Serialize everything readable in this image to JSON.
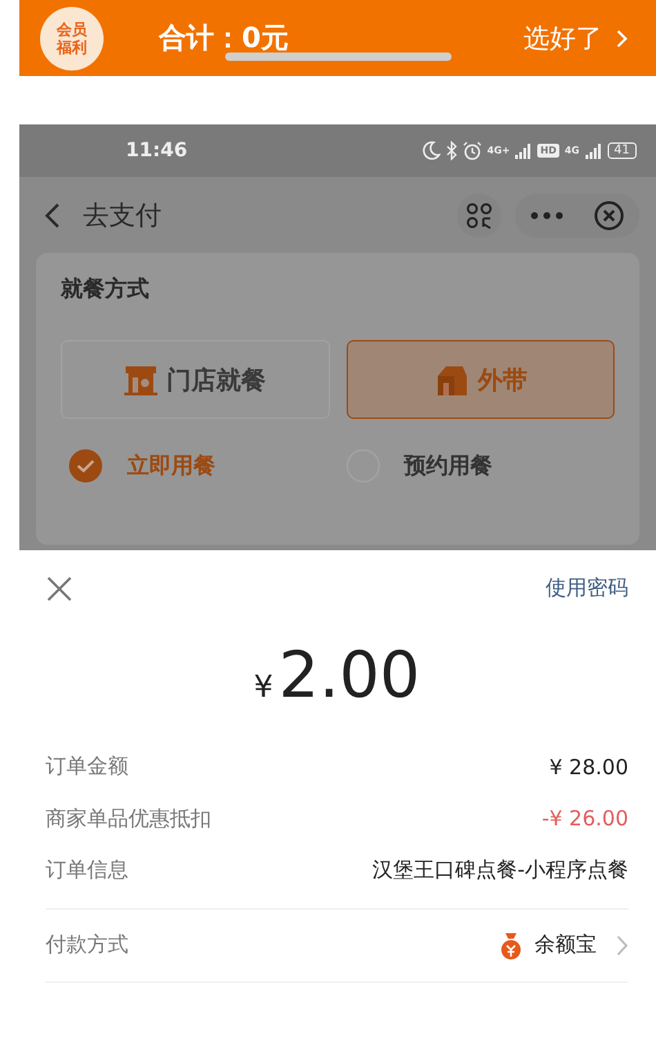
{
  "order_bar": {
    "badge_lines": [
      "会员",
      "福利"
    ],
    "total": "合计：0元",
    "confirm": "选好了"
  },
  "phone_screen": {
    "status_bar": {
      "time": "11:46",
      "network_labels": [
        "4G+",
        "HD",
        "4G"
      ],
      "battery": "41"
    },
    "nav": {
      "title": "去支付"
    },
    "dining_card": {
      "title": "就餐方式",
      "modes": [
        {
          "label": "门店就餐",
          "selected": false
        },
        {
          "label": "外带",
          "selected": true
        }
      ],
      "timing": [
        {
          "label": "立即用餐",
          "selected": true
        },
        {
          "label": "预约用餐",
          "selected": false
        }
      ]
    }
  },
  "payment_sheet": {
    "password_link": "使用密码",
    "currency": "¥",
    "amount": "2.00",
    "details": [
      {
        "label": "订单金额",
        "value": "¥ 28.00",
        "kind": "normal"
      },
      {
        "label": "商家单品优惠抵扣",
        "value": "-¥ 26.00",
        "kind": "discount"
      },
      {
        "label": "订单信息",
        "value": "汉堡王口碑点餐-小程序点餐",
        "kind": "normal"
      }
    ],
    "method": {
      "label": "付款方式",
      "value": "余额宝"
    }
  }
}
